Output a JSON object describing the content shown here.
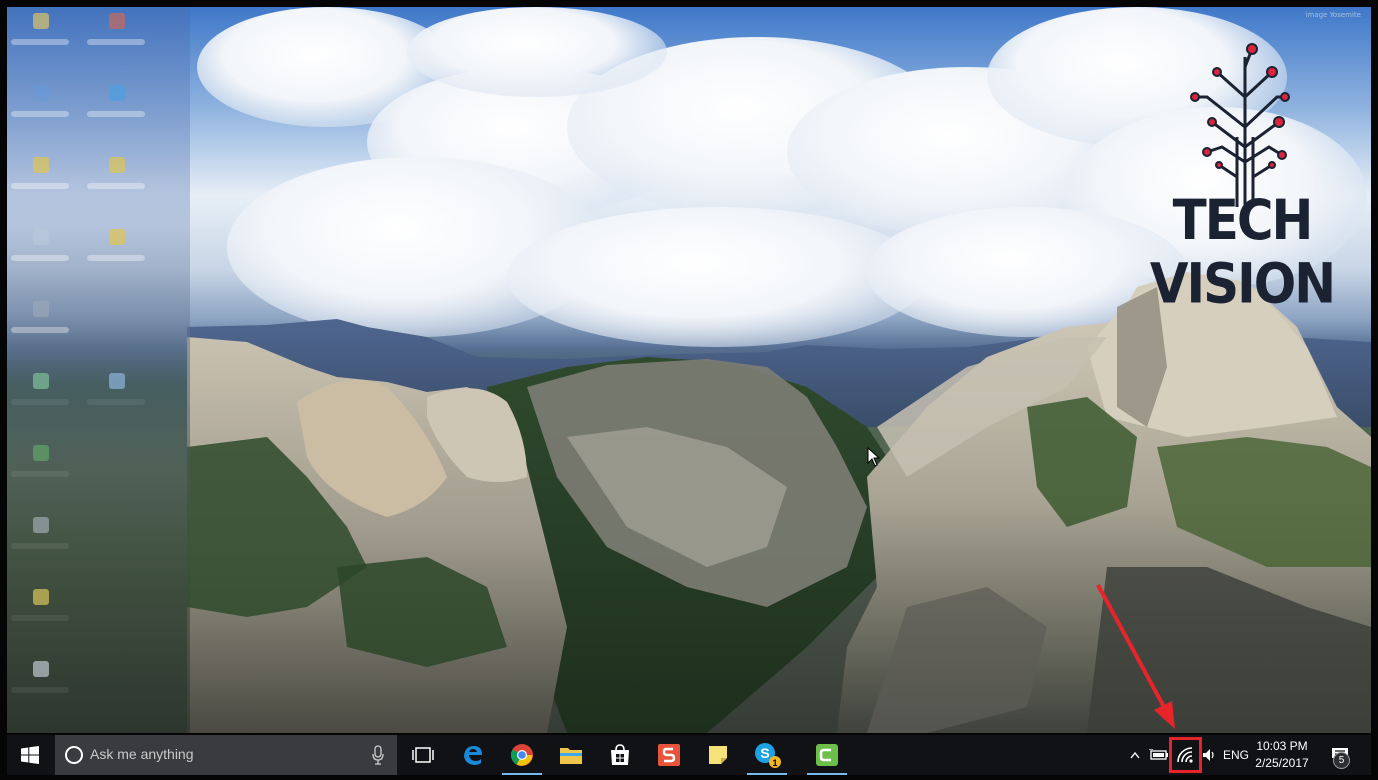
{
  "desktop": {
    "wallpaper": "mountain-valley-landscape",
    "logo_text": "TECH VISION",
    "logo_color": "#1b2232",
    "logo_accent": "#d8243c",
    "annotation_color": "#e8242b",
    "credit": "image Yosemite"
  },
  "taskbar": {
    "search_placeholder": "Ask me anything",
    "apps": [
      {
        "name": "task-view",
        "icon": "task-view-icon"
      },
      {
        "name": "edge",
        "icon": "edge-icon"
      },
      {
        "name": "chrome",
        "icon": "chrome-icon",
        "active": true
      },
      {
        "name": "file-explorer",
        "icon": "folder-icon"
      },
      {
        "name": "store",
        "icon": "store-icon"
      },
      {
        "name": "wps",
        "icon": "wps-icon"
      },
      {
        "name": "sticky-notes",
        "icon": "sticky-notes-icon"
      },
      {
        "name": "skype",
        "icon": "skype-icon",
        "active": true,
        "badge": "1"
      },
      {
        "name": "camtasia",
        "icon": "camtasia-icon",
        "active": true
      }
    ],
    "tray": {
      "language": "ENG",
      "time": "10:03 PM",
      "date": "2/25/2017",
      "notifications_count": "5"
    },
    "accent": "#76b9ed",
    "background": "#101216"
  }
}
